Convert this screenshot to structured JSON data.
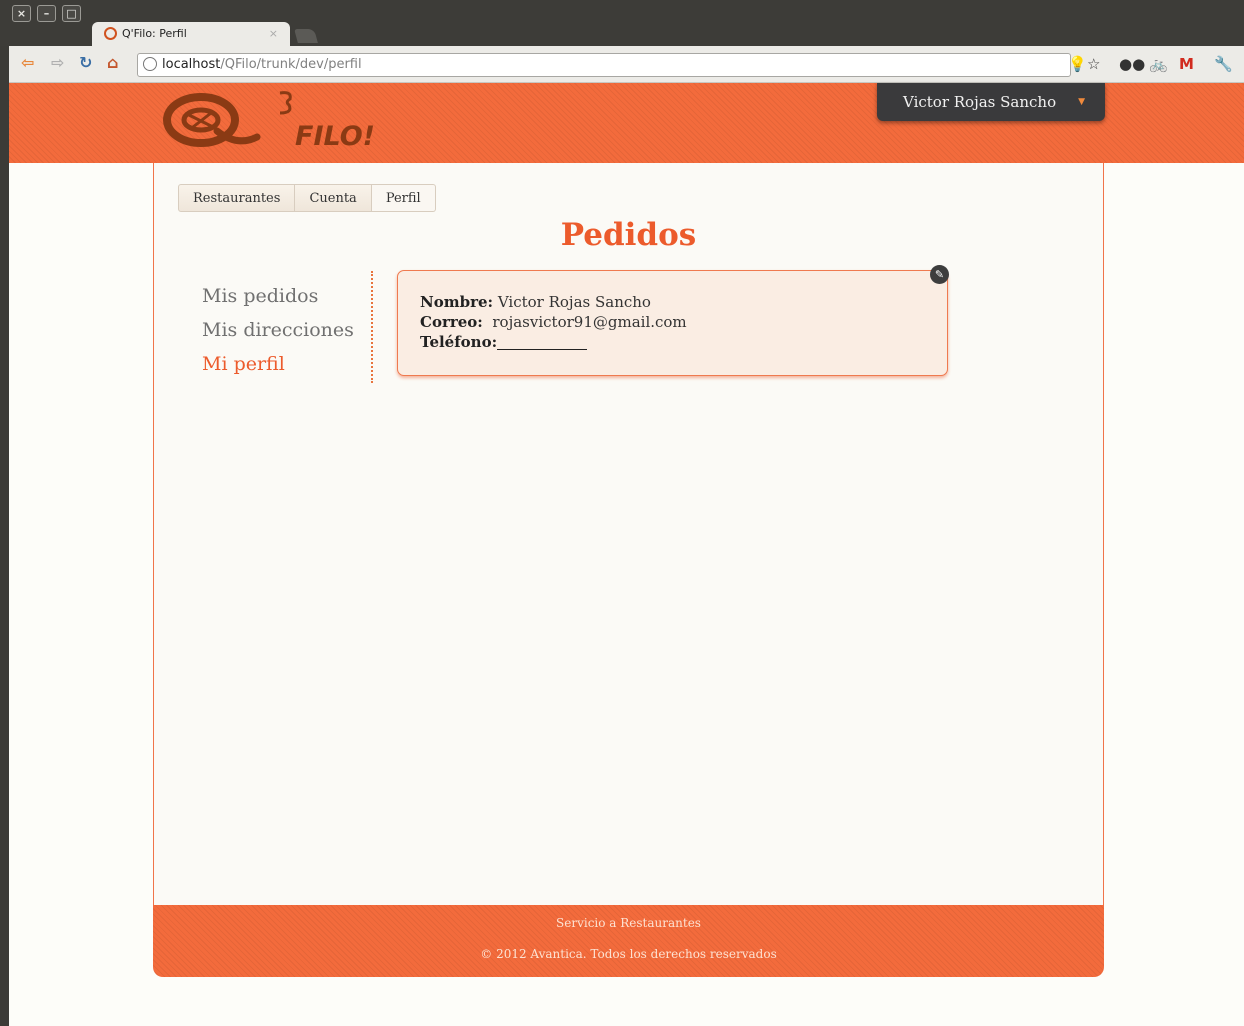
{
  "browser": {
    "tab_title": "Q'Filo: Perfil",
    "tab_close": "×",
    "url_host": "localhost",
    "url_path": "/QFilo/trunk/dev/perfil"
  },
  "header": {
    "logo_text": "FILO!",
    "user_name": "Victor Rojas Sancho"
  },
  "tabs": [
    "Restaurantes",
    "Cuenta",
    "Perfil"
  ],
  "page_title": "Pedidos",
  "sidebar": {
    "items": [
      {
        "label": "Mis pedidos",
        "active": false
      },
      {
        "label": "Mis direcciones",
        "active": false
      },
      {
        "label": "Mi perfil",
        "active": true
      }
    ]
  },
  "profile": {
    "nombre_label": "Nombre:",
    "nombre_value": "Victor Rojas Sancho",
    "correo_label": "Correo:",
    "correo_value": "rojasvictor91@gmail.com",
    "telefono_label": "Teléfono:",
    "telefono_value": ""
  },
  "footer": {
    "line1": "Servicio a Restaurantes",
    "line2": "© 2012 Avantica. Todos los derechos reservados"
  },
  "colors": {
    "accent": "#ec5b2c",
    "header_bg": "#f36b3c",
    "user_menu_bg": "#3a3a3c"
  }
}
